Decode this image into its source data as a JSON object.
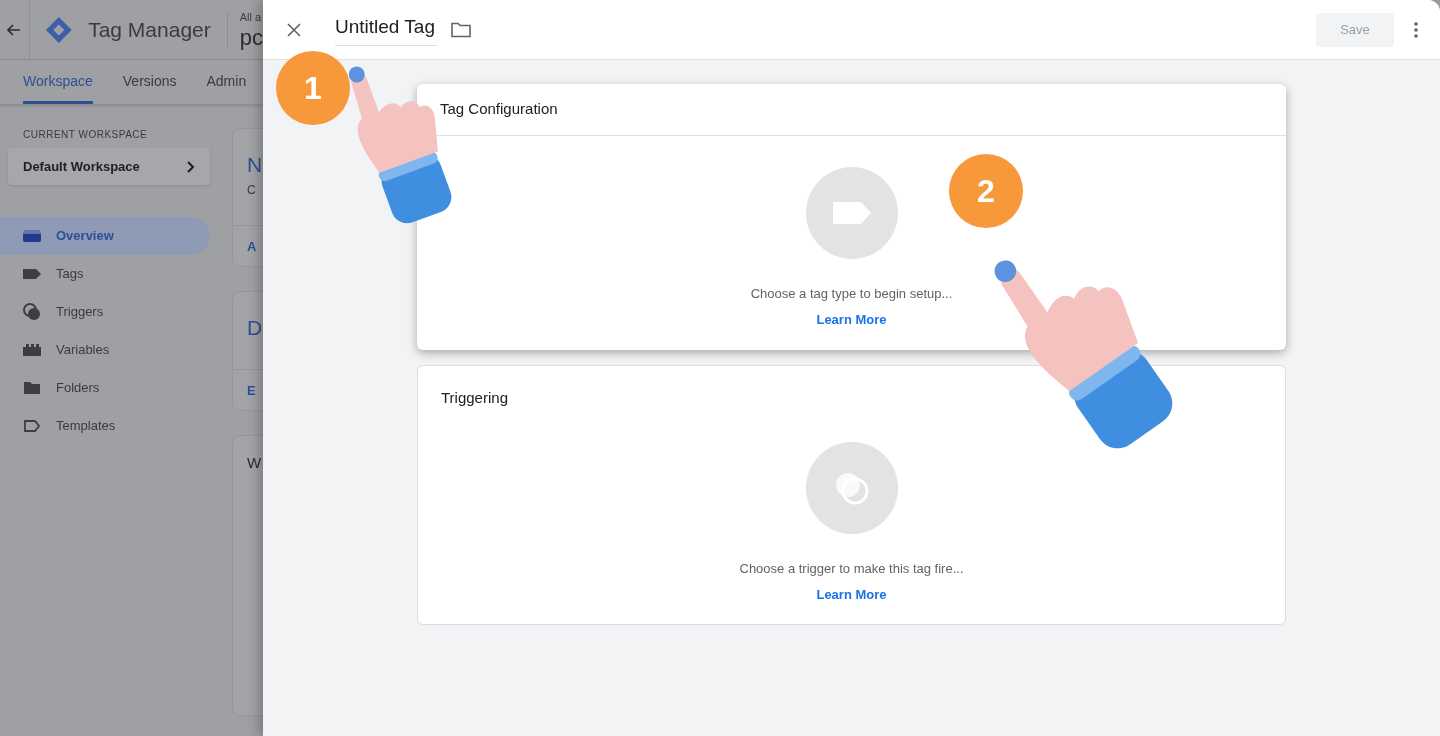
{
  "app": {
    "title": "Tag Manager",
    "account_label": "All a",
    "container_name": "pc",
    "tabs": [
      {
        "label": "Workspace",
        "selected": true
      },
      {
        "label": "Versions",
        "selected": false
      },
      {
        "label": "Admin",
        "selected": false
      }
    ],
    "workspace": {
      "label": "CURRENT WORKSPACE",
      "name": "Default Workspace"
    },
    "nav": [
      {
        "label": "Overview",
        "selected": true
      },
      {
        "label": "Tags",
        "selected": false
      },
      {
        "label": "Triggers",
        "selected": false
      },
      {
        "label": "Variables",
        "selected": false
      },
      {
        "label": "Folders",
        "selected": false
      },
      {
        "label": "Templates",
        "selected": false
      }
    ],
    "cards": [
      {
        "title": "N",
        "subtitle": "C",
        "link": "A"
      },
      {
        "title": "D",
        "link": "E"
      },
      {
        "title": "W"
      }
    ]
  },
  "tag_panel": {
    "title": "Untitled Tag",
    "save": {
      "label": "Save",
      "disabled": true
    },
    "sections": [
      {
        "kind": "tag",
        "title": "Tag Configuration",
        "hint": "Choose a tag type to begin setup...",
        "link": "Learn More",
        "focused": true
      },
      {
        "kind": "trigger",
        "title": "Triggering",
        "hint": "Choose a trigger to make this tag fire...",
        "link": "Learn More",
        "focused": false
      }
    ]
  },
  "steps": [
    {
      "number": "1"
    },
    {
      "number": "2"
    }
  ]
}
